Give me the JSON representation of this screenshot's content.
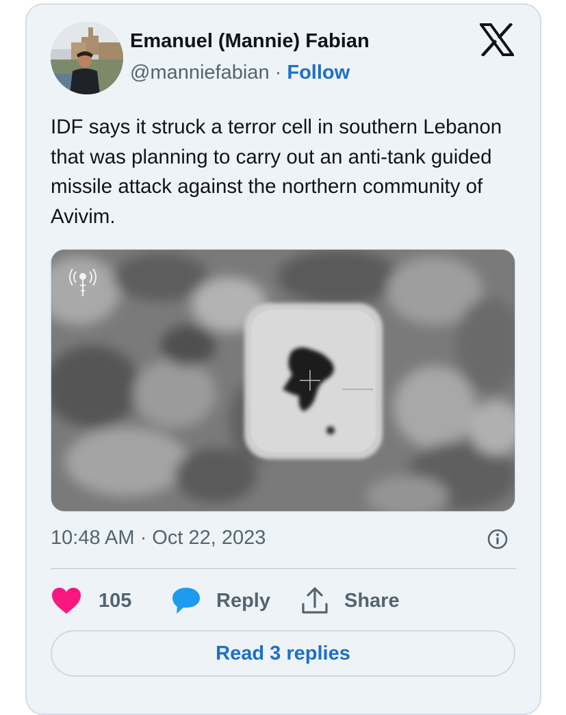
{
  "author": {
    "display_name": "Emanuel (Mannie) Fabian",
    "handle": "@manniefabian",
    "separator": "·",
    "follow_label": "Follow"
  },
  "brand_icon": "x-logo-icon",
  "tweet": {
    "text": "IDF says it struck a terror cell in southern Lebanon that was planning to carry out an anti-tank guided missile attack against the northern community of Avivim.",
    "timestamp": "10:48 AM · Oct 22, 2023"
  },
  "media": {
    "kind": "aerial-surveillance-video-still",
    "watermark_icon": "antenna-signal-icon"
  },
  "actions": {
    "likes_count": "105",
    "reply_label": "Reply",
    "share_label": "Share"
  },
  "read_replies_label": "Read 3 replies",
  "colors": {
    "card_background": "#eef3f7",
    "link_blue": "#1d6fc9",
    "heart": "#f91880",
    "reply_bubble": "#1d9bf0",
    "muted_text": "#536471"
  }
}
